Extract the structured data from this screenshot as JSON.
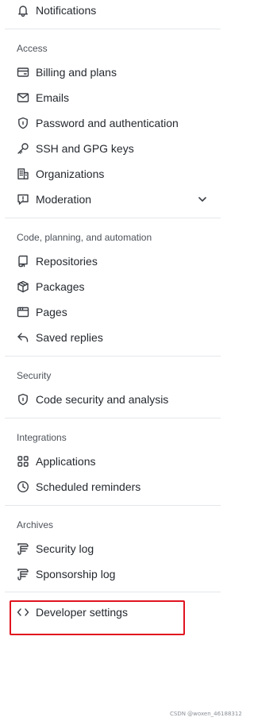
{
  "top": {
    "notifications": "Notifications"
  },
  "access": {
    "header": "Access",
    "items": [
      "Billing and plans",
      "Emails",
      "Password and authentication",
      "SSH and GPG keys",
      "Organizations",
      "Moderation"
    ]
  },
  "code": {
    "header": "Code, planning, and automation",
    "items": [
      "Repositories",
      "Packages",
      "Pages",
      "Saved replies"
    ]
  },
  "security": {
    "header": "Security",
    "items": [
      "Code security and analysis"
    ]
  },
  "integrations": {
    "header": "Integrations",
    "items": [
      "Applications",
      "Scheduled reminders"
    ]
  },
  "archives": {
    "header": "Archives",
    "items": [
      "Security log",
      "Sponsorship log"
    ]
  },
  "developer": {
    "label": "Developer settings"
  },
  "watermark": "CSDN @woxen_46188312",
  "colors": {
    "highlight": "#e0141f",
    "separator": "#e5e7ea",
    "text": "#24292f"
  }
}
